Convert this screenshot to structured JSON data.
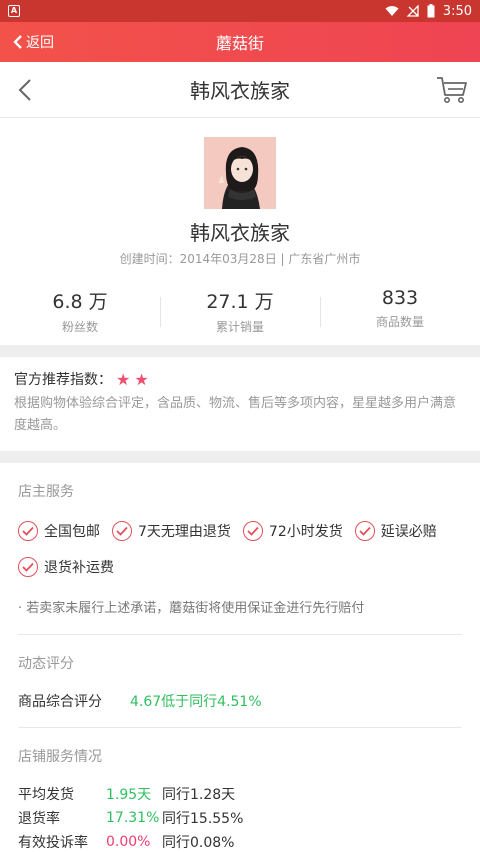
{
  "status_bar": {
    "time": "3:50"
  },
  "app_bar": {
    "back_label": "返回",
    "title": "蘑菇街"
  },
  "nav": {
    "title": "韩风衣族家"
  },
  "shop": {
    "name": "韩风衣族家",
    "meta": "创建时间：2014年03月28日 | 广东省广州市",
    "stats": [
      {
        "value": "6.8 万",
        "label": "粉丝数"
      },
      {
        "value": "27.1 万",
        "label": "累计销量"
      },
      {
        "value": "833",
        "label": "商品数量"
      }
    ]
  },
  "recommend": {
    "title": "官方推荐指数：",
    "stars": 2,
    "description": "根据购物体验综合评定，含品质、物流、售后等多项内容，星星越多用户满意度越高。"
  },
  "owner_service": {
    "title": "店主服务",
    "badges": [
      "全国包邮",
      "7天无理由退货",
      "72小时发货",
      "延误必赔",
      "退货补运费"
    ],
    "note": "· 若卖家未履行上述承诺，蘑菇街将使用保证金进行先行赔付"
  },
  "dynamic_score": {
    "title": "动态评分",
    "label": "商品综合评分",
    "value": "4.67低于同行4.51%"
  },
  "service_status": {
    "title": "店铺服务情况",
    "rows": [
      {
        "label": "平均发货",
        "value": "1.95天",
        "peer": "同行1.28天"
      },
      {
        "label": "退货率",
        "value": "17.31%",
        "peer": "同行15.55%"
      },
      {
        "label": "有效投诉率",
        "value": "0.00%",
        "peer": "同行0.08%"
      }
    ]
  },
  "colors": {
    "accent": "#ef4453",
    "green": "#2fbf5f",
    "pink": "#f03e6e",
    "star": "#f0506e"
  }
}
